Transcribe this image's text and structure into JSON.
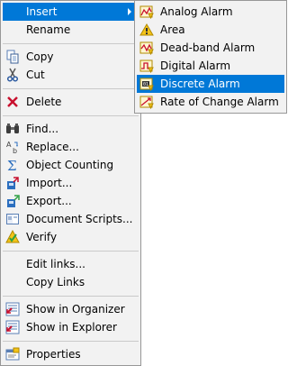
{
  "main_menu": {
    "insert": "Insert",
    "rename": "Rename",
    "copy": "Copy",
    "cut": "Cut",
    "delete": "Delete",
    "find": "Find...",
    "replace": "Replace...",
    "object_counting": "Object Counting",
    "import": "Import...",
    "export": "Export...",
    "document_scripts": "Document Scripts...",
    "verify": "Verify",
    "edit_links": "Edit links...",
    "copy_links": "Copy Links",
    "show_in_organizer": "Show in Organizer",
    "show_in_explorer": "Show in Explorer",
    "properties": "Properties"
  },
  "submenu": {
    "items": [
      {
        "label": "Analog Alarm"
      },
      {
        "label": "Area"
      },
      {
        "label": "Dead-band Alarm"
      },
      {
        "label": "Digital Alarm"
      },
      {
        "label": "Discrete Alarm"
      },
      {
        "label": "Rate of Change Alarm"
      }
    ],
    "highlighted": "Discrete Alarm"
  },
  "colors": {
    "highlight": "#0078d7",
    "menu_bg": "#f2f2f2",
    "separator": "#cacaca"
  }
}
